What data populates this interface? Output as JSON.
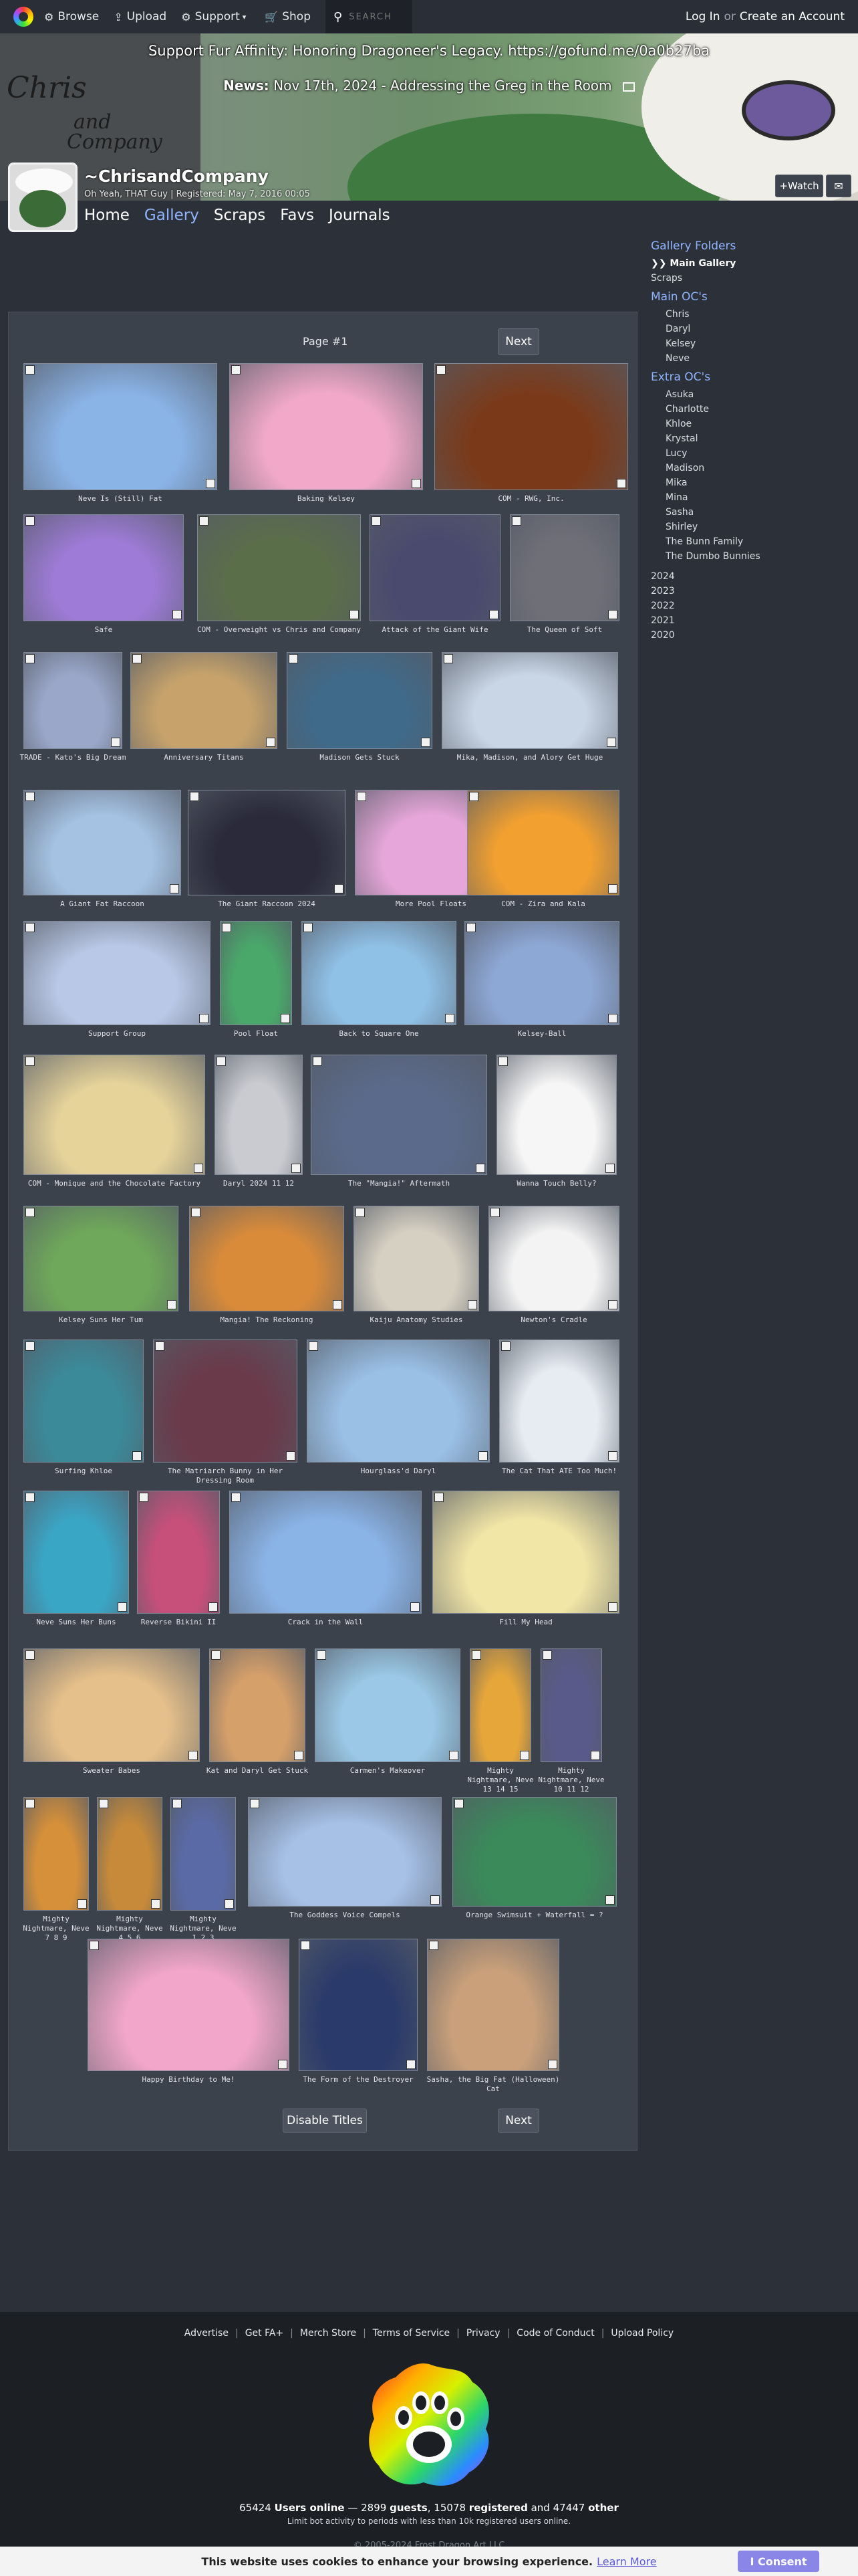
{
  "nav": {
    "browse": "Browse",
    "upload": "Upload",
    "support": "Support",
    "shop": "Shop",
    "search_placeholder": "SEARCH",
    "login": "Log In",
    "or": "or",
    "create_account": "Create an Account"
  },
  "banner": {
    "message": "Support Fur Affinity: Honoring Dragoneer's Legacy. https://gofund.me/0a0b27ba",
    "news_label": "News:",
    "news_text": "Nov 17th, 2024 - Addressing the Greg in the Room",
    "logo_line1": "Chris",
    "logo_line2": "and",
    "logo_line3": "Company"
  },
  "profile": {
    "username": "~ChrisandCompany",
    "subtitle": "Oh Yeah, THAT Guy | Registered: May 7, 2016 00:05",
    "watch": "+Watch",
    "tabs": [
      "Home",
      "Gallery",
      "Scraps",
      "Favs",
      "Journals"
    ]
  },
  "pager": {
    "page_label": "Page #1",
    "next": "Next",
    "disable_titles": "Disable Titles"
  },
  "thumbs": [
    "Neve Is (Still) Fat",
    "Baking Kelsey",
    "COM - RWG, Inc.",
    "Safe",
    "COM - Overweight vs Chris and Company",
    "Attack of the Giant Wife",
    "The Queen of Soft",
    "TRADE - Kato's Big Dream",
    "Anniversary Titans",
    "Madison Gets Stuck",
    "Mika, Madison, and Alory Get Huge",
    "A Giant Fat Raccoon",
    "The Giant Raccoon 2024",
    "More Pool Floats",
    "COM - Zira and Kala",
    "Support Group",
    "Pool Float",
    "Back to Square One",
    "Kelsey-Ball",
    "COM - Monique and the Chocolate Factory",
    "Daryl 2024 11 12",
    "The \"Mangia!\" Aftermath",
    "Wanna Touch Belly?",
    "Kelsey Suns Her Tum",
    "Mangia! The Reckoning",
    "Kaiju Anatomy Studies",
    "Newton's Cradle",
    "Surfing Khloe",
    "The Matriarch Bunny in Her Dressing Room",
    "Hourglass'd Daryl",
    "The Cat That ATE Too Much!",
    "Neve Suns Her Buns",
    "Reverse Bikini II",
    "Crack in the Wall",
    "Fill My Head",
    "Sweater Babes",
    "Kat and Daryl Get Stuck",
    "Carmen's Makeover",
    "Mighty Nightmare, Neve 13 14 15",
    "Mighty Nightmare, Neve 10 11 12",
    "Mighty Nightmare, Neve 7 8 9",
    "Mighty Nightmare, Neve 4 5 6",
    "Mighty Nightmare, Neve 1 2 3",
    "The Goddess Voice Compels",
    "Orange Swimsuit + Waterfall = ?",
    "Happy Birthday to Me!",
    "The Form of the Destroyer",
    "Sasha, the Big Fat (Halloween) Cat"
  ],
  "thumb_colors": [
    "#8ab3e6",
    "#f2a9c9",
    "#7a3a1a",
    "#9d7bd6",
    "#5b6e4a",
    "#4a4a6e",
    "#6f6f78",
    "#9aa7c9",
    "#c7a36b",
    "#3f6a8a",
    "#c9d6e6",
    "#a5c2e3",
    "#2a2a3a",
    "#e6a6d9",
    "#f2a030",
    "#b9c8e6",
    "#4aa86a",
    "#8fc0e6",
    "#8ea8d6",
    "#e6d39a",
    "#c9cbd0",
    "#5b6a8a",
    "#f6f6f6",
    "#6fa85a",
    "#d98b3a",
    "#d6d0c2",
    "#f3f3f3",
    "#3b8a9a",
    "#6a3a4a",
    "#9ac0e6",
    "#e6ecf2",
    "#3aa6c6",
    "#c6507a",
    "#8ab3e6",
    "#f2e6a6",
    "#e6c08a",
    "#d6a06a",
    "#9ac8e6",
    "#e6a63a",
    "#5a5a8a",
    "#d6903a",
    "#c68a3a",
    "#5a6aa6",
    "#a6c0e6",
    "#3a8a5a",
    "#f2a6c9",
    "#2a3a6a",
    "#c9a07a"
  ],
  "sidebar": {
    "folders_heading": "Gallery Folders",
    "main_gallery": "Main Gallery",
    "scraps": "Scraps",
    "main_ocs_heading": "Main OC's",
    "main_ocs": [
      "Chris",
      "Daryl",
      "Kelsey",
      "Neve"
    ],
    "extra_ocs_heading": "Extra OC's",
    "extra_ocs": [
      "Asuka",
      "Charlotte",
      "Khloe",
      "Krystal",
      "Lucy",
      "Madison",
      "Mika",
      "Mina",
      "Sasha",
      "Shirley",
      "The Bunn Family",
      "The Dumbo Bunnies"
    ],
    "years": [
      "2024",
      "2023",
      "2022",
      "2021",
      "2020"
    ]
  },
  "footer": {
    "links": [
      "Advertise",
      "Get FA+",
      "Merch Store",
      "Terms of Service",
      "Privacy",
      "Code of Conduct",
      "Upload Policy"
    ],
    "users_online_num": "65424",
    "users_online": "Users online",
    "dash": "—",
    "guests_num": "2899",
    "guests": "guests",
    "registered_num": "15078",
    "registered": "registered",
    "and": "and",
    "other_num": "47447",
    "other": "other",
    "note": "Limit bot activity to periods with less than 10k registered users online.",
    "copyright": "© 2005-2024 Frost Dragon Art LLC"
  },
  "cookie": {
    "text": "This website uses cookies to enhance your browsing experience.",
    "learn_more": "Learn More",
    "consent": "I Consent"
  }
}
